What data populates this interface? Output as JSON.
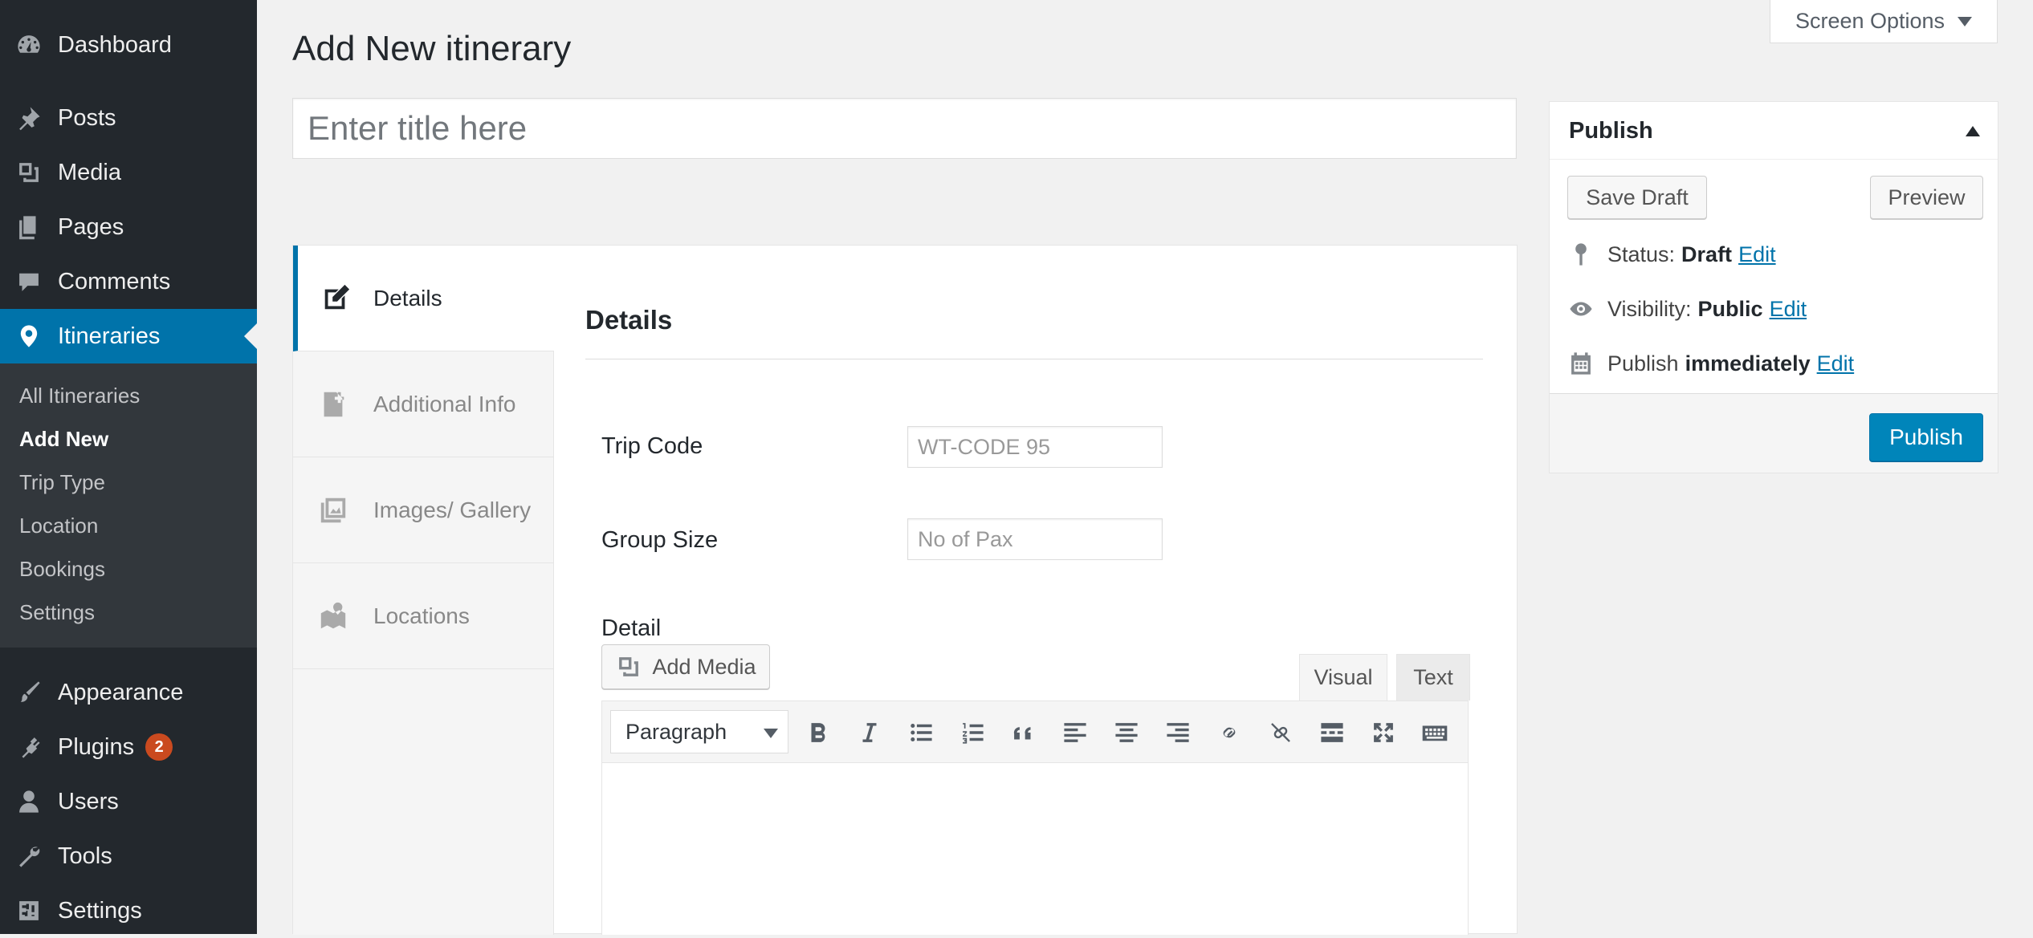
{
  "sidebar": {
    "menu": [
      {
        "key": "dashboard",
        "label": "Dashboard",
        "icon": "dashboard-icon"
      },
      {
        "key": "posts",
        "label": "Posts",
        "icon": "pushpin-icon"
      },
      {
        "key": "media",
        "label": "Media",
        "icon": "media-icon"
      },
      {
        "key": "pages",
        "label": "Pages",
        "icon": "pages-icon"
      },
      {
        "key": "comments",
        "label": "Comments",
        "icon": "comment-icon"
      },
      {
        "key": "itineraries",
        "label": "Itineraries",
        "icon": "location-pin-icon",
        "active": true
      },
      {
        "key": "appearance",
        "label": "Appearance",
        "icon": "paintbrush-icon"
      },
      {
        "key": "plugins",
        "label": "Plugins",
        "icon": "plugin-icon",
        "badge": "2"
      },
      {
        "key": "users",
        "label": "Users",
        "icon": "user-icon"
      },
      {
        "key": "tools",
        "label": "Tools",
        "icon": "wrench-icon"
      },
      {
        "key": "settings",
        "label": "Settings",
        "icon": "settings-sliders-icon"
      }
    ],
    "submenu": [
      "All Itineraries",
      "Add New",
      "Trip Type",
      "Location",
      "Bookings",
      "Settings"
    ],
    "submenu_current": "Add New"
  },
  "header": {
    "title": "Add New itinerary",
    "screen_options": "Screen Options"
  },
  "title_field": {
    "placeholder": "Enter title here",
    "value": ""
  },
  "metabox": {
    "tabs": [
      {
        "label": "Details",
        "icon": "edit-page-icon",
        "active": true
      },
      {
        "label": "Additional Info",
        "icon": "add-page-icon"
      },
      {
        "label": "Images/ Gallery",
        "icon": "gallery-icon"
      },
      {
        "label": "Locations",
        "icon": "map-icon"
      }
    ],
    "panel_heading": "Details",
    "fields": {
      "trip_code": {
        "label": "Trip Code",
        "placeholder": "WT-CODE 95",
        "value": ""
      },
      "group_size": {
        "label": "Group Size",
        "placeholder": "No of Pax",
        "value": ""
      },
      "detail": {
        "label": "Detail"
      }
    },
    "editor": {
      "add_media": "Add Media",
      "tab_visual": "Visual",
      "tab_text": "Text",
      "format": "Paragraph",
      "toolbar_icons": [
        "bold-icon",
        "italic-icon",
        "bullet-list-icon",
        "numbered-list-icon",
        "blockquote-icon",
        "align-left-icon",
        "align-center-icon",
        "align-right-icon",
        "link-icon",
        "unlink-icon",
        "read-more-icon",
        "fullscreen-icon",
        "toolbar-toggle-icon"
      ]
    }
  },
  "publish": {
    "title": "Publish",
    "save_draft": "Save Draft",
    "preview": "Preview",
    "status_label": "Status:",
    "status_value": "Draft",
    "visibility_label": "Visibility:",
    "visibility_value": "Public",
    "publish_label": "Publish",
    "publish_value": "immediately",
    "edit_link": "Edit",
    "publish_button": "Publish"
  },
  "colors": {
    "sidebar_bg": "#23282d",
    "active_menu": "#0073aa",
    "primary_button": "#0085ba",
    "badge": "#ca4a1f"
  }
}
